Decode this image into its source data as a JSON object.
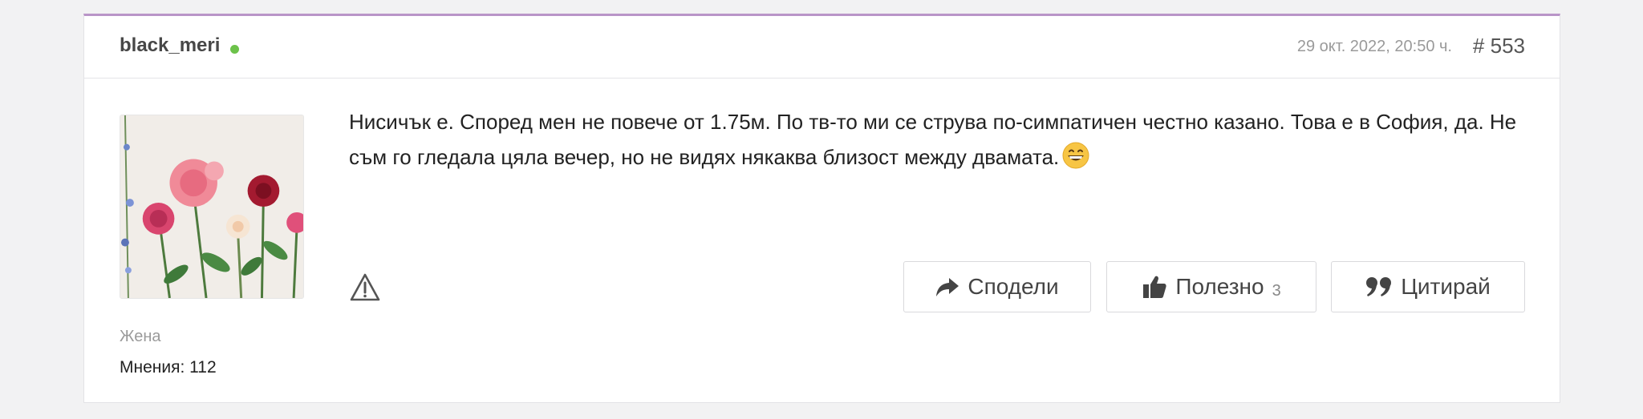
{
  "post": {
    "username": "black_meri",
    "online": true,
    "date": "29 окт. 2022, 20:50 ч.",
    "number": "# 553",
    "author": {
      "gender": "Жена",
      "opinions": "Мнения: 112"
    },
    "message": "Нисичък е. Според мен не повече от 1.75м. По тв-то ми се струва по-симпатичен честно казано. Това е в София, да. Не съм го гледала цяла вечер, но не видях някаква близост между двамата.",
    "actions": {
      "share_label": "Сподели",
      "useful_label": "Полезно",
      "useful_count": "3",
      "quote_label": "Цитирай"
    }
  },
  "icons": {
    "online": "online-dot",
    "report": "warning-triangle-icon",
    "share": "share-arrow-icon",
    "useful": "thumbs-up-icon",
    "quote": "quote-icon",
    "emoji": "grinning-face-emoji"
  },
  "colors": {
    "accent_border": "#b995c8",
    "online": "#6cc24a",
    "background": "#f2f2f3"
  }
}
